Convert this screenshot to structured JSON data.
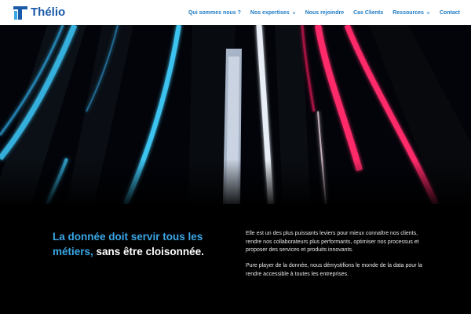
{
  "brand": {
    "name": "Thélio",
    "logo_color": "#1a5aa8"
  },
  "nav": {
    "items": [
      {
        "label": "Qui sommes nous ?",
        "has_dropdown": false
      },
      {
        "label": "Nos expertises",
        "has_dropdown": true
      },
      {
        "label": "Nous rejoindre",
        "has_dropdown": false
      },
      {
        "label": "Cas Clients",
        "has_dropdown": false
      },
      {
        "label": "Ressources",
        "has_dropdown": true
      },
      {
        "label": "Contact",
        "has_dropdown": false
      }
    ],
    "link_color": "#1f7bc4"
  },
  "hero": {
    "image_alt": "Abstract light trails",
    "colors": {
      "blue": "#39b8e6",
      "red": "#ff2a6a",
      "white": "#e8eef5"
    }
  },
  "section": {
    "headline_highlight": "La donnée doit servir tous les métiers,",
    "headline_rest": " sans être cloisonnée.",
    "highlight_color": "#3aa6e6",
    "paragraph_1": "Elle est un des plus puissants leviers pour mieux connaître nos clients, rendre nos collaborateurs plus performants, optimiser nos processus et proposer des services et produits innovants.",
    "paragraph_2": "Pure player de la donnée, nous démystifions le monde de la data pour la rendre accessible à toutes les entreprises."
  }
}
